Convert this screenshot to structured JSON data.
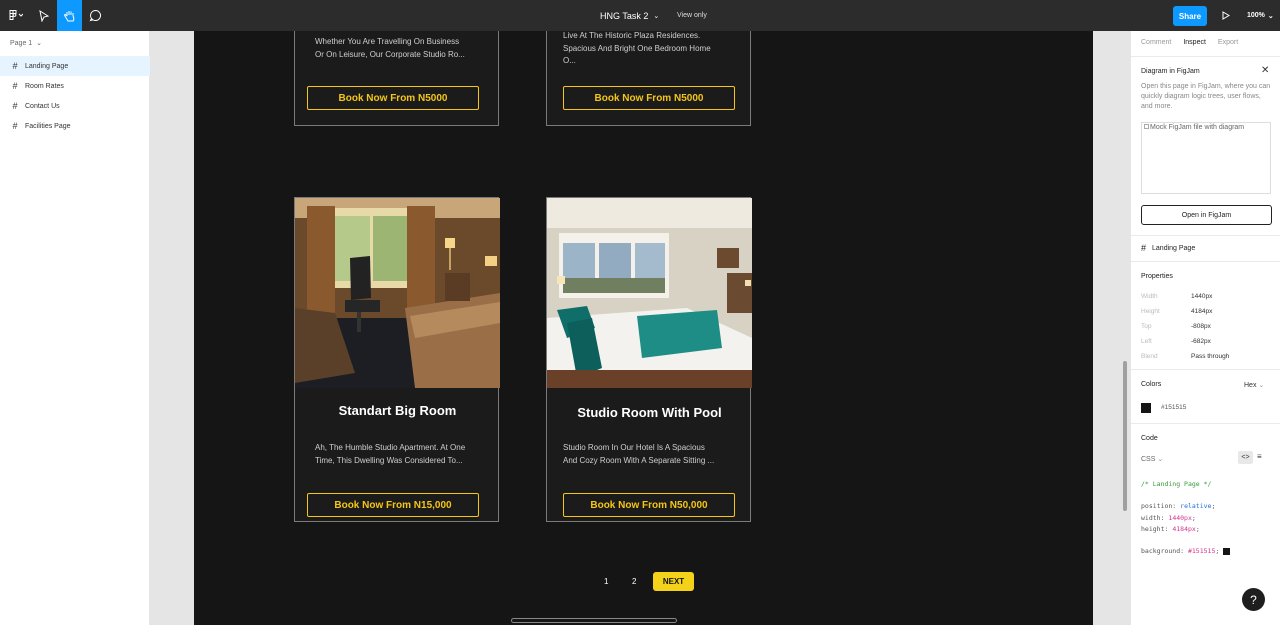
{
  "topbar": {
    "file_name": "HNG Task 2",
    "view_mode": "View only",
    "share_label": "Share",
    "zoom": "100%"
  },
  "left_panel": {
    "page_selector": "Page 1",
    "layers": [
      {
        "label": "Landing Page",
        "selected": true
      },
      {
        "label": "Room Rates",
        "selected": false
      },
      {
        "label": "Contact Us",
        "selected": false
      },
      {
        "label": "Facilities Page",
        "selected": false
      }
    ]
  },
  "canvas": {
    "top_cards": [
      {
        "desc_lines": [
          "Whether You Are Travelling On Business",
          "Or On Leisure, Our Corporate Studio Ro..."
        ],
        "button": "Book Now From N5000"
      },
      {
        "desc_lines": [
          "Live At The Historic Plaza Residences.",
          "Spacious And Bright One Bedroom Home",
          "O..."
        ],
        "button": "Book Now From N5000"
      }
    ],
    "bottom_cards": [
      {
        "title": "Standart Big Room",
        "desc_lines": [
          "Ah, The Humble Studio Apartment. At One",
          "Time, This Dwelling Was Considered To..."
        ],
        "button": "Book Now From N15,000",
        "image_alt": "hotel room"
      },
      {
        "title": "Studio Room With Pool",
        "desc_lines": [
          "Studio Room In Our Hotel Is A Spacious",
          "And Cozy Room With A Separate Sitting ..."
        ],
        "button": "Book Now From N50,000",
        "image_alt": "studio room"
      }
    ],
    "pagination": {
      "pages": [
        "1",
        "2"
      ],
      "next_label": "NEXT"
    }
  },
  "right_panel": {
    "tabs": [
      "Comment",
      "Inspect",
      "Export"
    ],
    "active_tab": "Inspect",
    "figjam": {
      "title": "Diagram in FigJam",
      "description": "Open this page in FigJam, where you can quickly diagram logic trees, user flows, and more.",
      "image_alt": "Mock FigJam file with diagram",
      "button": "Open in FigJam"
    },
    "selection_name": "Landing Page",
    "properties_title": "Properties",
    "properties": [
      {
        "key": "Width",
        "value": "1440px"
      },
      {
        "key": "Height",
        "value": "4184px"
      },
      {
        "key": "Top",
        "value": "-808px"
      },
      {
        "key": "Left",
        "value": "-682px"
      },
      {
        "key": "Blend",
        "value": "Pass through"
      }
    ],
    "colors_title": "Colors",
    "color_format": "Hex",
    "color_value": "#151515",
    "code_title": "Code",
    "code_lang": "CSS",
    "code": {
      "comment": "/* Landing Page */",
      "lines": [
        {
          "prop": "position:",
          "val": "relative",
          "type": "kw"
        },
        {
          "prop": "width:",
          "val": "1440px",
          "type": "num"
        },
        {
          "prop": "height:",
          "val": "4184px",
          "type": "num"
        }
      ],
      "bg_prop": "background:",
      "bg_val": "#151515"
    }
  },
  "colors": {
    "accent": "#0d99ff",
    "frame_bg": "#151515",
    "gold": "#f5c518",
    "next_yellow": "#f5d21a"
  },
  "help_label": "?"
}
